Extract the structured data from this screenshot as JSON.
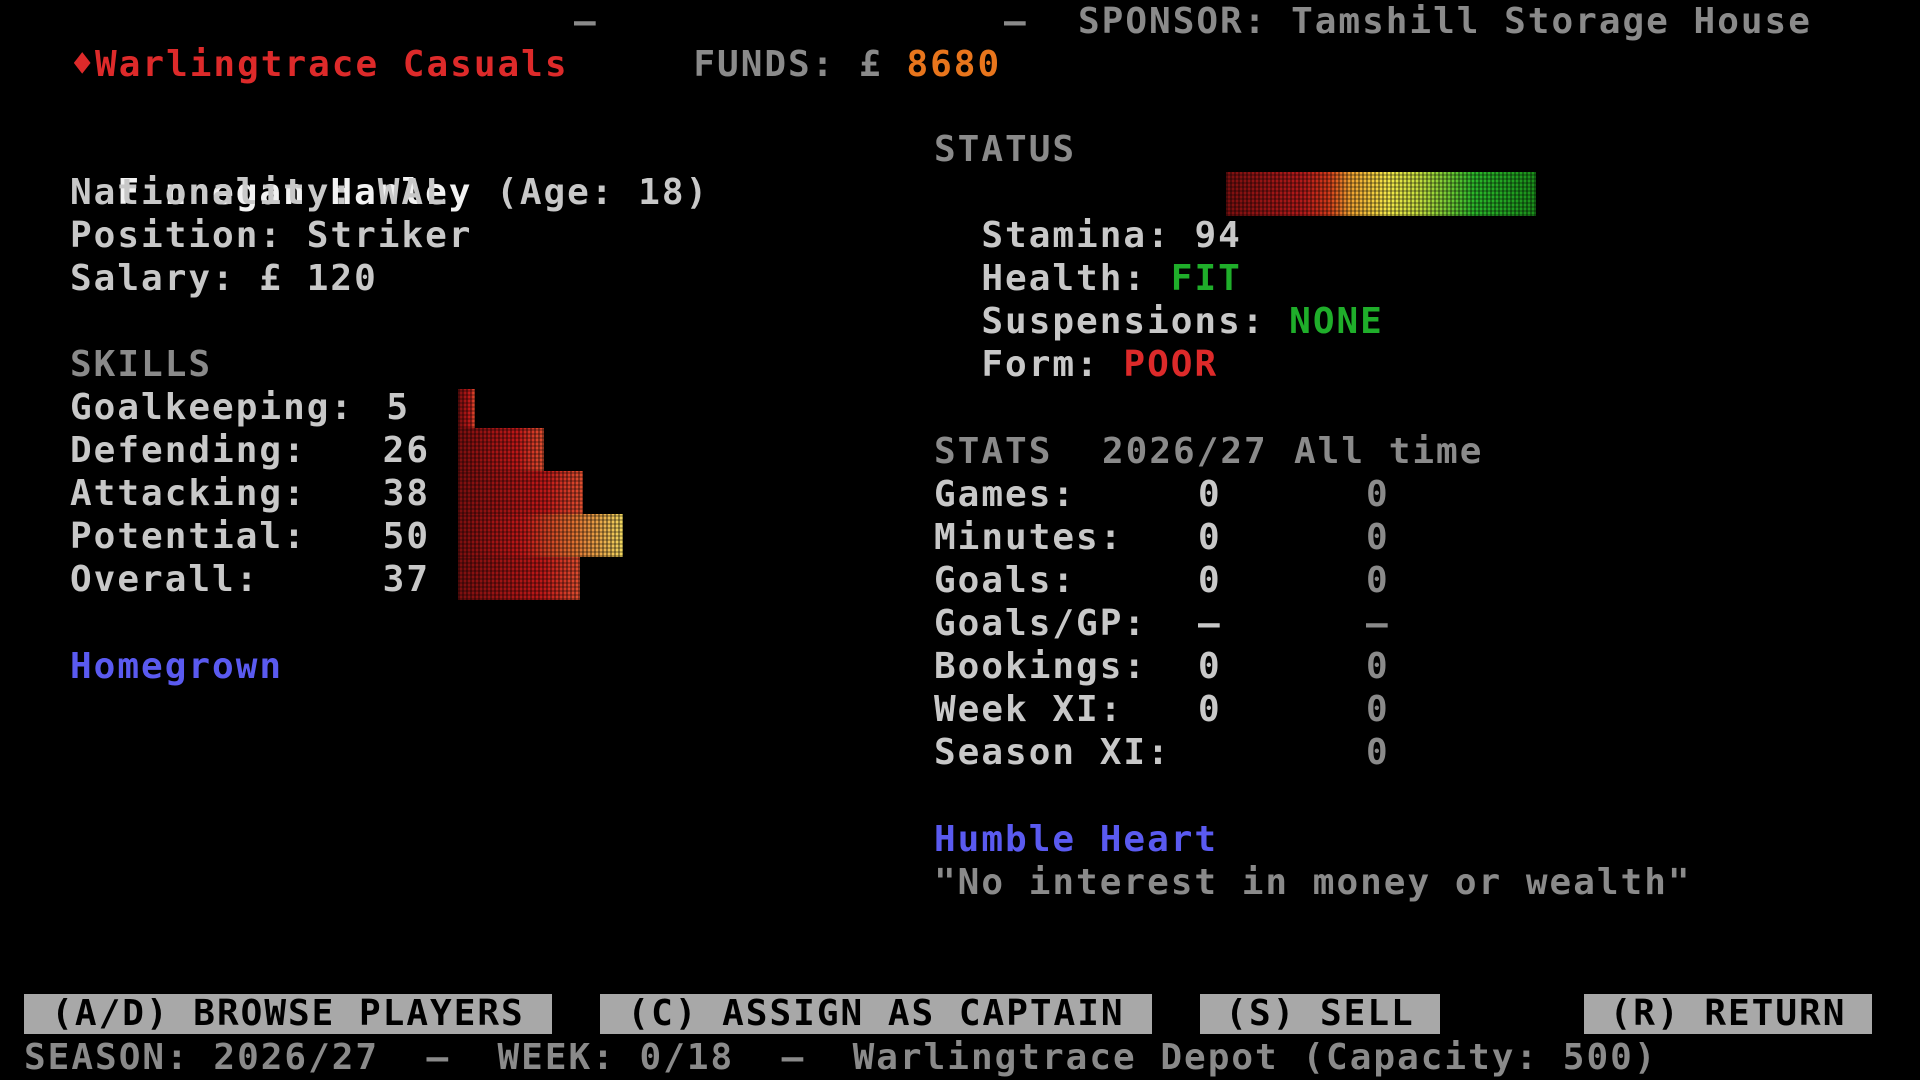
{
  "header": {
    "diamond": "♦",
    "club": "Warlingtrace Casuals",
    "sep1": "—",
    "funds_label": "FUNDS: £",
    "funds_value": "8680",
    "sep2": "—",
    "sponsor": "SPONSOR: Tamshill Storage House"
  },
  "player": {
    "name": "Finnegan Hanley",
    "age": "(Age: 18)",
    "nationality": "Nationality: WAL",
    "position": "Position: Striker",
    "salary": "Salary: £ 120"
  },
  "skills": {
    "heading": "SKILLS",
    "rows": [
      {
        "label": "Goalkeeping:",
        "value": "5"
      },
      {
        "label": "Defending:",
        "value": "26"
      },
      {
        "label": "Attacking:",
        "value": "38"
      },
      {
        "label": "Potential:",
        "value": "50"
      },
      {
        "label": "Overall:",
        "value": "37"
      }
    ],
    "values": [
      5,
      26,
      38,
      50,
      37
    ],
    "tag": "Homegrown"
  },
  "status": {
    "heading": "STATUS",
    "stamina_label": "Stamina:",
    "stamina_value": "94",
    "health_label": "Health:",
    "health_value": "FIT",
    "suspensions_label": "Suspensions:",
    "suspensions_value": "NONE",
    "form_label": "Form:",
    "form_value": "POOR",
    "colors": {
      "good": "#1fae2a",
      "bad": "#dd2a2a"
    }
  },
  "stats": {
    "heading": "STATS",
    "col_season": "2026/27",
    "col_all": "All time",
    "rows": [
      {
        "label": "Games:",
        "season": "0",
        "all": "0"
      },
      {
        "label": "Minutes:",
        "season": "0",
        "all": "0"
      },
      {
        "label": "Goals:",
        "season": "0",
        "all": "0"
      },
      {
        "label": "Goals/GP:",
        "season": "—",
        "all": "—"
      },
      {
        "label": "Bookings:",
        "season": "0",
        "all": "0"
      },
      {
        "label": "Week XI:",
        "season": "0",
        "all": "0"
      },
      {
        "label": "Season XI:",
        "season": "",
        "all": "0"
      }
    ]
  },
  "trait": {
    "name": "Humble Heart",
    "quote": "\"No interest in money or wealth\""
  },
  "buttons": {
    "browse": "(A/D) BROWSE PLAYERS",
    "captain": "(C) ASSIGN AS CAPTAIN",
    "sell": "(S) SELL",
    "return": "(R) RETURN"
  },
  "footer": "SEASON: 2026/27  —  WEEK: 0/18  —  Warlingtrace Depot (Capacity: 500)"
}
